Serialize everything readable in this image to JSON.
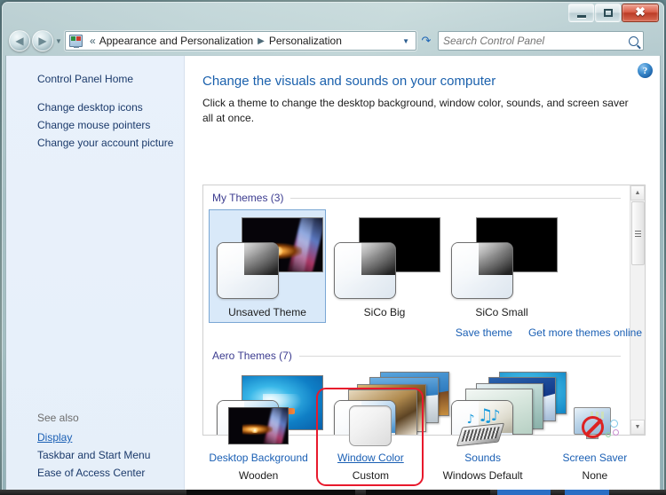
{
  "window": {
    "controls": {
      "minimize": "–",
      "maximize": "□",
      "close": "✕"
    }
  },
  "addressbar": {
    "back_label": "◀",
    "forward_label": "▶",
    "history_label": "▾",
    "separator": "«",
    "crumb1": "Appearance and Personalization",
    "crumb_chevron": "▶",
    "crumb2": "Personalization",
    "dropdown_label": "▾",
    "refresh_label": "↯",
    "cp_icon": "control-panel-icon"
  },
  "search": {
    "placeholder": "Search Control Panel",
    "value": "",
    "icon": "search-icon"
  },
  "sidebar": {
    "home_label": "Control Panel Home",
    "links": [
      "Change desktop icons",
      "Change mouse pointers",
      "Change your account picture"
    ],
    "see_also_title": "See also",
    "see_also": [
      {
        "label": "Display",
        "active": true
      },
      {
        "label": "Taskbar and Start Menu",
        "active": false
      },
      {
        "label": "Ease of Access Center",
        "active": false
      }
    ]
  },
  "content": {
    "help_label": "?",
    "title": "Change the visuals and sounds on your computer",
    "subtitle": "Click a theme to change the desktop background, window color, sounds, and screen saver all at once.",
    "groups": [
      {
        "title": "My Themes (3)",
        "themes": [
          {
            "label": "Unsaved Theme",
            "selected": true,
            "style": "unsaved"
          },
          {
            "label": "SiCo Big",
            "selected": false,
            "style": "black"
          },
          {
            "label": "SiCo Small",
            "selected": false,
            "style": "black"
          }
        ]
      },
      {
        "title": "Aero Themes (7)",
        "themes": [
          {
            "label": "",
            "selected": false,
            "style": "aero-water"
          },
          {
            "label": "",
            "selected": false,
            "style": "aero-stack-a"
          },
          {
            "label": "",
            "selected": false,
            "style": "aero-stack-b"
          }
        ]
      }
    ],
    "links": [
      "Save theme",
      "Get more themes online"
    ],
    "scrollbar": {
      "up": "▲",
      "down": "▼"
    }
  },
  "settings": [
    {
      "name": "Desktop Background",
      "value": "Wooden",
      "icon": "desktop-background-icon",
      "highlighted": false,
      "hovered": false
    },
    {
      "name": "Window Color",
      "value": "Custom",
      "icon": "window-color-icon",
      "highlighted": true,
      "hovered": true
    },
    {
      "name": "Sounds",
      "value": "Windows Default",
      "icon": "sounds-icon",
      "highlighted": false,
      "hovered": false
    },
    {
      "name": "Screen Saver",
      "value": "None",
      "icon": "screen-saver-icon",
      "highlighted": false,
      "hovered": false
    }
  ],
  "colors": {
    "link": "#1a5fb4",
    "heading": "#1b61ad",
    "group_title": "#3b3b8f",
    "annotation": "#e8192c",
    "selection": "#d9e9f9"
  }
}
